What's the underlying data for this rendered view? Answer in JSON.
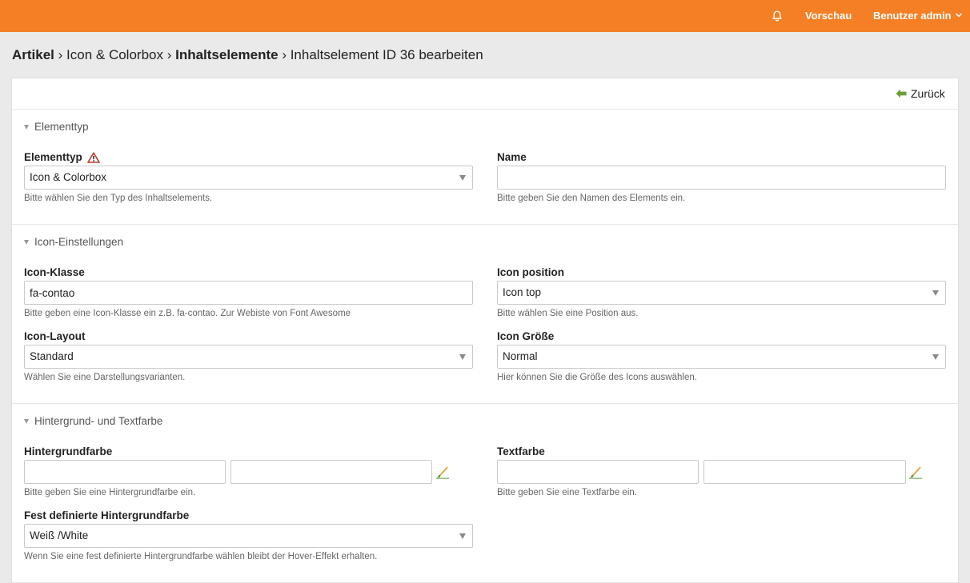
{
  "header": {
    "notifications_icon": "bell-icon",
    "preview_label": "Vorschau",
    "user_label": "Benutzer admin",
    "accent_color": "#f47f24"
  },
  "breadcrumb": {
    "item1": "Artikel",
    "sep1": " › ",
    "item2": "Icon & Colorbox",
    "sep2": " › ",
    "item3": "Inhaltselemente",
    "sep3": " › ",
    "current": "Inhaltselement ID 36 bearbeiten"
  },
  "back": {
    "label": "Zurück",
    "icon": "arrow-left-icon"
  },
  "sections": {
    "elementtyp": {
      "legend": "Elementtyp"
    },
    "icon": {
      "legend": "Icon-Einstellungen"
    },
    "colors": {
      "legend": "Hintergrund- und Textfarbe"
    }
  },
  "fields": {
    "type": {
      "label": "Elementtyp",
      "value": "Icon & Colorbox",
      "help": "Bitte wählen Sie den Typ des Inhaltselements."
    },
    "name": {
      "label": "Name",
      "value": "",
      "help": "Bitte geben Sie den Namen des Elements ein."
    },
    "icon_class": {
      "label": "Icon-Klasse",
      "value": "fa-contao",
      "help": "Bitte geben eine Icon-Klasse ein z.B. fa-contao. Zur Webiste von Font Awesome"
    },
    "icon_position": {
      "label": "Icon position",
      "value": "Icon top",
      "help": "Bitte wählen Sie eine Position aus."
    },
    "icon_layout": {
      "label": "Icon-Layout",
      "value": "Standard",
      "help": "Wählen Sie eine Darstellungsvarianten."
    },
    "icon_size": {
      "label": "Icon Größe",
      "value": "Normal",
      "help": "Hier können Sie die Größe des Icons auswählen."
    },
    "bg_color": {
      "label": "Hintergrundfarbe",
      "value1": "",
      "value2": "",
      "help": "Bitte geben Sie eine Hintergrundfarbe ein."
    },
    "text_color": {
      "label": "Textfarbe",
      "value1": "",
      "value2": "",
      "help": "Bitte geben Sie eine Textfarbe ein."
    },
    "fixed_bg": {
      "label": "Fest definierte Hintergrundfarbe",
      "value": "Weiß /White",
      "help": "Wenn Sie eine fest definierte Hintergrundfarbe wählen bleibt der Hover-Effekt erhalten."
    }
  }
}
